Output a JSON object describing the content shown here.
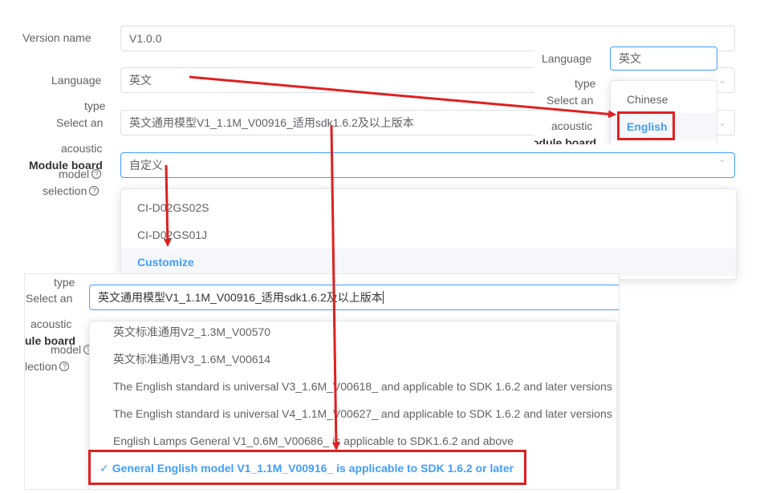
{
  "form": {
    "version_name_label": "Version name",
    "version_name_value": "V1.0.0",
    "language_label": "Language",
    "language_value": "英文",
    "acoustic_label_1": "type",
    "acoustic_label_2": "Select an",
    "acoustic_label_3": "acoustic",
    "acoustic_value": "英文通用模型V1_1.1M_V00916_适用sdk1.6.2及以上版本",
    "module_label_1": "Module board",
    "module_label_2": "model",
    "module_label_3": "selection",
    "module_value": "自定义",
    "help_glyph": "?"
  },
  "module_dropdown": {
    "options": [
      "CI-D02GS02S",
      "CI-D02GS01J",
      "Customize"
    ],
    "selected_index": 2
  },
  "language_popup": {
    "label": "Language",
    "value": "英文",
    "type_label": "type",
    "select_label": "Select an",
    "acoustic_label": "acoustic",
    "module_label": "odule board",
    "options": [
      "Chinese",
      "English"
    ],
    "selected_index": 1
  },
  "acoustic_popup": {
    "type_label": "type",
    "select_label": "Select an",
    "acoustic_label": "acoustic",
    "module_label": "ule board",
    "model_label": "model",
    "selection_label": "lection",
    "input_value": "英文通用模型V1_1.1M_V00916_适用sdk1.6.2及以上版本",
    "options": [
      "英文标准通用V2_1.3M_V00570",
      "英文标准通用V3_1.6M_V00614",
      "The English standard is universal V3_1.6M_V00618_ and applicable to SDK 1.6.2 and later versions",
      "The English standard is universal V4_1.1M_V00627_ and applicable to SDK 1.6.2 and later versions",
      "English Lamps General V1_0.6M_V00686_ is applicable to SDK1.6.2 and above",
      "General English model V1_1.1M_V00916_ is applicable to SDK 1.6.2 or later"
    ],
    "selected_index": 5,
    "check_glyph": "✓"
  },
  "colors": {
    "accent": "#409eff",
    "annotation_red": "#e02020",
    "border": "#dcdfe6"
  }
}
